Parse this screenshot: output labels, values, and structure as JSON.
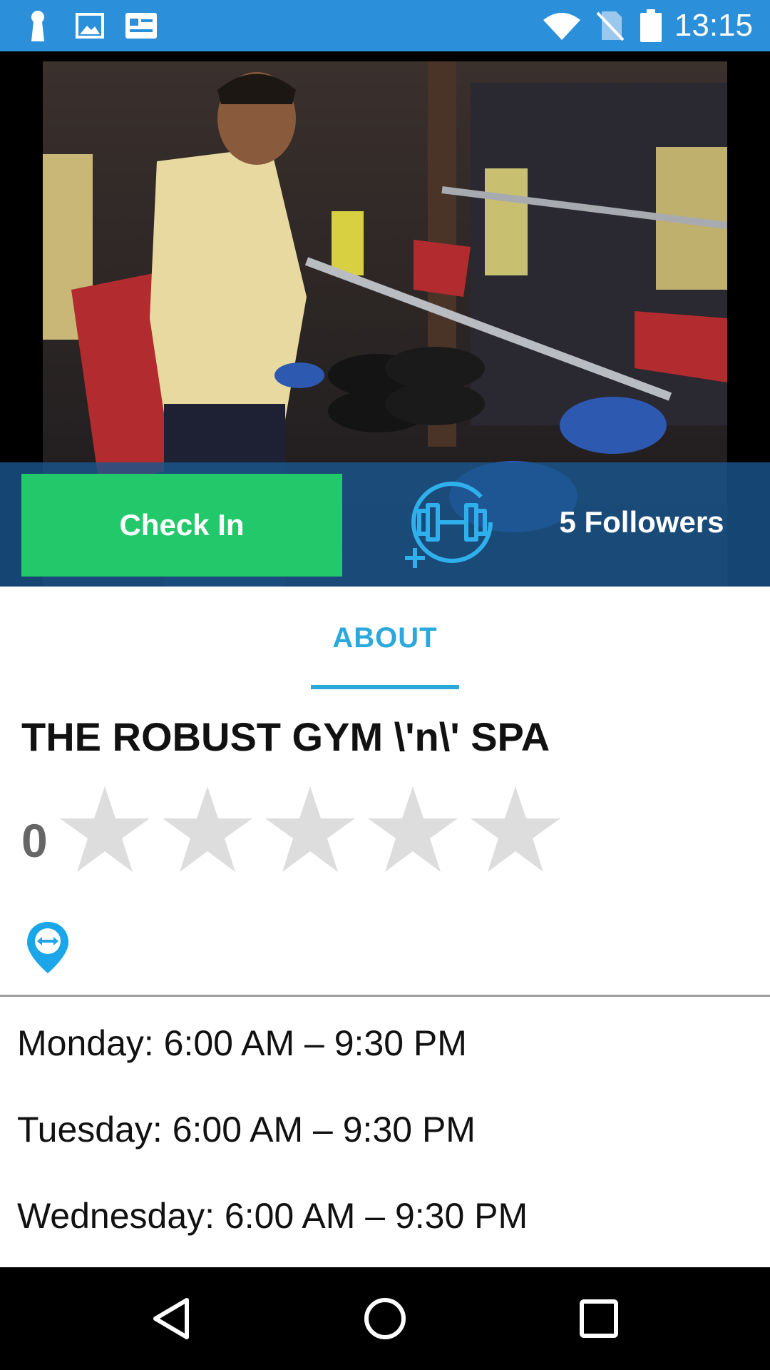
{
  "status_bar": {
    "time": "13:15",
    "icons": [
      "keyhole-notification-icon",
      "image-notification-icon",
      "news-notification-icon",
      "wifi-icon",
      "no-sim-icon",
      "battery-icon"
    ]
  },
  "hero": {
    "photo": "gym-photo",
    "check_in_label": "Check In",
    "follow_icon": "add-dumbbell-icon",
    "followers_label": "5 Followers"
  },
  "tabs": {
    "about_label": "ABOUT"
  },
  "gym": {
    "name": "THE ROBUST GYM \\'n\\' SPA",
    "rating_value": "0",
    "rating_stars_filled": 0,
    "rating_stars_total": 5,
    "location_icon": "location-pin-icon"
  },
  "hours": [
    "Monday: 6:00 AM – 9:30 PM",
    "Tuesday: 6:00 AM – 9:30 PM",
    "Wednesday: 6:00 AM – 9:30 PM"
  ],
  "nav_bar": {
    "icons": [
      "back-triangle-icon",
      "home-circle-icon",
      "recents-square-icon"
    ]
  },
  "colors": {
    "status_bar": "#2b8fd9",
    "check_in": "#23c86b",
    "accent": "#2ba8dc",
    "star_empty": "#dddddd"
  }
}
